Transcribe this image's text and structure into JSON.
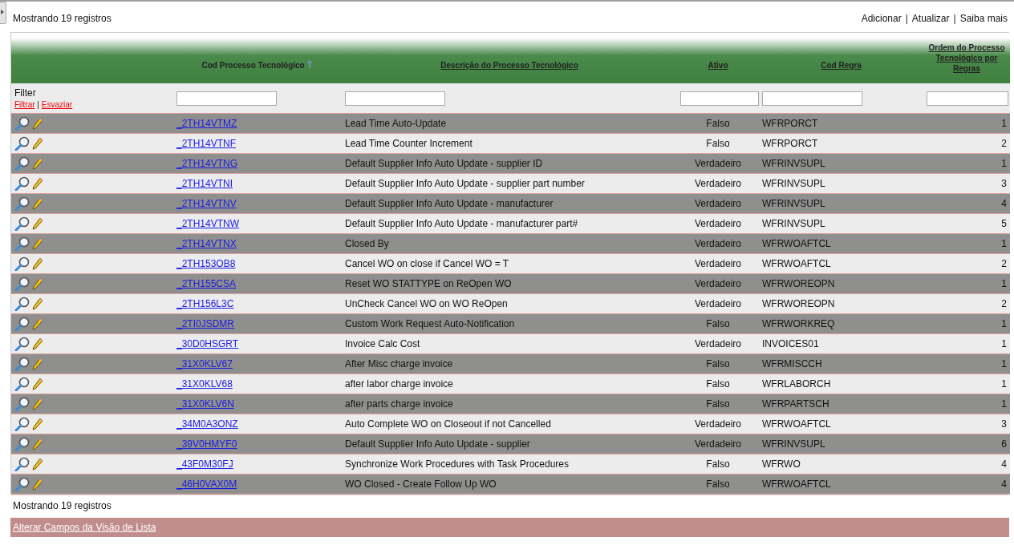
{
  "top_count": "Mostrando 19 registros",
  "actions": [
    "Adicionar",
    "Atualizar",
    "Saiba mais"
  ],
  "separator": "|",
  "table": {
    "columns": [
      {
        "label": "Cod Processo Tecnológico",
        "sorted": true
      },
      {
        "label": "Descrição do Processo Tecnológico",
        "sorted": false
      },
      {
        "label": "Ativo",
        "sorted": false
      },
      {
        "label": "Cod Regra",
        "sorted": false
      },
      {
        "label": "Ordem do Processo Tecnológico por Regras",
        "sorted": false
      }
    ],
    "filter": {
      "label": "Filter",
      "links": [
        "Filtrar",
        "Esvaziar"
      ]
    },
    "rows": [
      [
        "_2TH14VTMZ",
        "Lead Time Auto-Update",
        "Falso",
        "WFRPORCT",
        "1"
      ],
      [
        "_2TH14VTNF",
        "Lead Time Counter Increment",
        "Falso",
        "WFRPORCT",
        "2"
      ],
      [
        "_2TH14VTNG",
        "Default Supplier Info Auto Update - supplier ID",
        "Verdadeiro",
        "WFRINVSUPL",
        "1"
      ],
      [
        "_2TH14VTNI",
        "Default Supplier Info Auto Update - supplier part number",
        "Verdadeiro",
        "WFRINVSUPL",
        "3"
      ],
      [
        "_2TH14VTNV",
        "Default Supplier Info Auto Update - manufacturer",
        "Verdadeiro",
        "WFRINVSUPL",
        "4"
      ],
      [
        "_2TH14VTNW",
        "Default Supplier Info Auto Update - manufacturer part#",
        "Verdadeiro",
        "WFRINVSUPL",
        "5"
      ],
      [
        "_2TH14VTNX",
        "Closed By",
        "Verdadeiro",
        "WFRWOAFTCL",
        "1"
      ],
      [
        "_2TH153OB8",
        "Cancel WO on close if Cancel WO = T",
        "Verdadeiro",
        "WFRWOAFTCL",
        "2"
      ],
      [
        "_2TH155CSA",
        "Reset WO STATTYPE on ReOpen WO",
        "Verdadeiro",
        "WFRWOREOPN",
        "1"
      ],
      [
        "_2TH156L3C",
        "UnCheck Cancel WO on WO ReOpen",
        "Verdadeiro",
        "WFRWOREOPN",
        "2"
      ],
      [
        "_2TI0JSDMR",
        "Custom Work Request Auto-Notification",
        "Falso",
        "WFRWORKREQ",
        "1"
      ],
      [
        "_30D0HSGRT",
        "Invoice Calc Cost",
        "Verdadeiro",
        "INVOICES01",
        "1"
      ],
      [
        "_31X0KLV67",
        "After Misc charge invoice",
        "Falso",
        "WFRMISCCH",
        "1"
      ],
      [
        "_31X0KLV68",
        "after labor charge invoice",
        "Falso",
        "WFRLABORCH",
        "1"
      ],
      [
        "_31X0KLV6N",
        "after parts charge invoice",
        "Falso",
        "WFRPARTSCH",
        "1"
      ],
      [
        "_34M0A3ONZ",
        "Auto Complete WO on Closeout if not Cancelled",
        "Verdadeiro",
        "WFRWOAFTCL",
        "3"
      ],
      [
        "_39V0HMYF0",
        "Default Supplier Info Auto Update - supplier",
        "Verdadeiro",
        "WFRINVSUPL",
        "6"
      ],
      [
        "_43F0M30FJ",
        "Synchronize Work Procedures with Task Procedures",
        "Falso",
        "WFRWO",
        "4"
      ],
      [
        "_46H0VAX0M",
        "WO Closed - Create Follow Up WO",
        "Falso",
        "WFRWOAFTCL",
        "4"
      ]
    ]
  },
  "bottom_count": "Mostrando 19 registros",
  "footer_link": "Alterar Campos da Visão de Lista"
}
